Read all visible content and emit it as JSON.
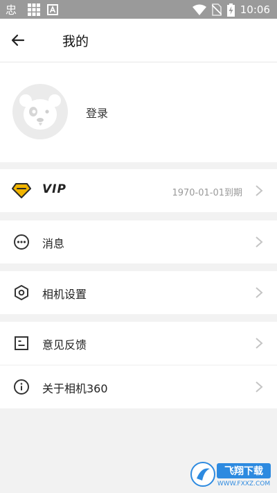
{
  "status_bar": {
    "time": "10:06",
    "icons": [
      "app-notification-icon",
      "grid-icon",
      "keyboard-icon",
      "wifi-icon",
      "no-sim-icon",
      "battery-charging-icon"
    ]
  },
  "app_bar": {
    "title": "我的",
    "back_icon": "arrow-left-icon"
  },
  "profile": {
    "login_label": "登录",
    "avatar": "default-avatar-icon"
  },
  "vip": {
    "label": "VIP",
    "expiry": "1970-01-01到期",
    "icon": "diamond-icon",
    "accent": "#f1b400"
  },
  "menu": {
    "messages": "消息",
    "camera_settings": "相机设置",
    "feedback": "意见反馈",
    "about": "关于相机360"
  },
  "watermark": {
    "text": "飞翔下载",
    "url": "WWW.FXXZ.COM"
  }
}
